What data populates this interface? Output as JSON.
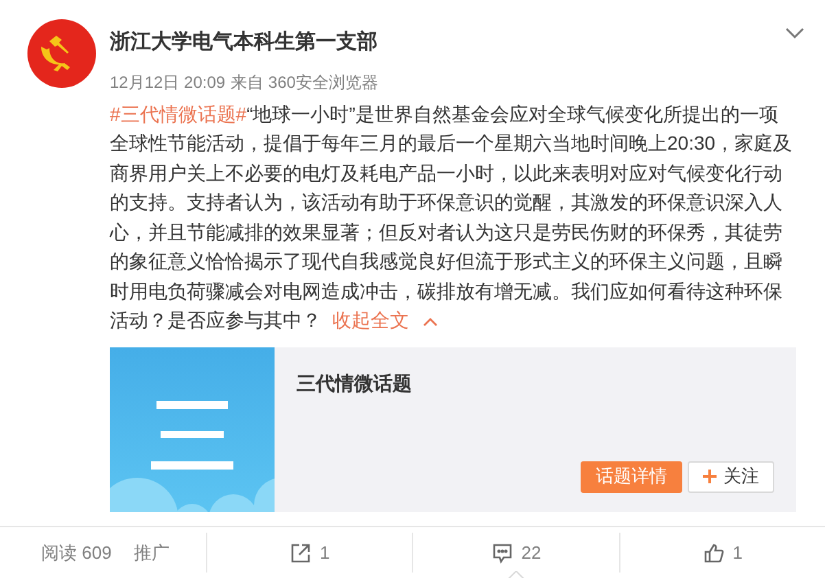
{
  "post": {
    "author": "浙江大学电气本科生第一支部",
    "time": "12月12日 20:09",
    "source": "来自 360安全浏览器",
    "hashtag": "#三代情微话题#",
    "text": "“地球一小时”是世界自然基金会应对全球气候变化所提出的一项全球性节能活动，提倡于每年三月的最后一个星期六当地时间晚上20:30，家庭及商界用户关上不必要的电灯及耗电产品一小时，以此来表明对应对气候变化行动的支持。支持者认为，该活动有助于环保意识的觉醒，其激发的环保意识深入人心，并且节能减排的效果显著；但反对者认为这只是劳民伤财的环保秀，其徒劳的象征意义恰恰揭示了现代自我感觉良好但流于形式主义的环保主义问题，且瞬时用电负荷骤减会对电网造成冲击，碳排放有增无减。我们应如何看待这种环保活动？是否应参与其中？",
    "collapse_link": "收起全文"
  },
  "card": {
    "title": "三代情微话题",
    "details_button": "话题详情",
    "follow_button": "关注"
  },
  "footer": {
    "reads": "阅读 609",
    "promote": "推广",
    "actions": [
      {
        "kind": "share",
        "count": "1",
        "selected": false
      },
      {
        "kind": "comment",
        "count": "22",
        "selected": true
      },
      {
        "kind": "like",
        "count": "1",
        "selected": false
      }
    ]
  }
}
